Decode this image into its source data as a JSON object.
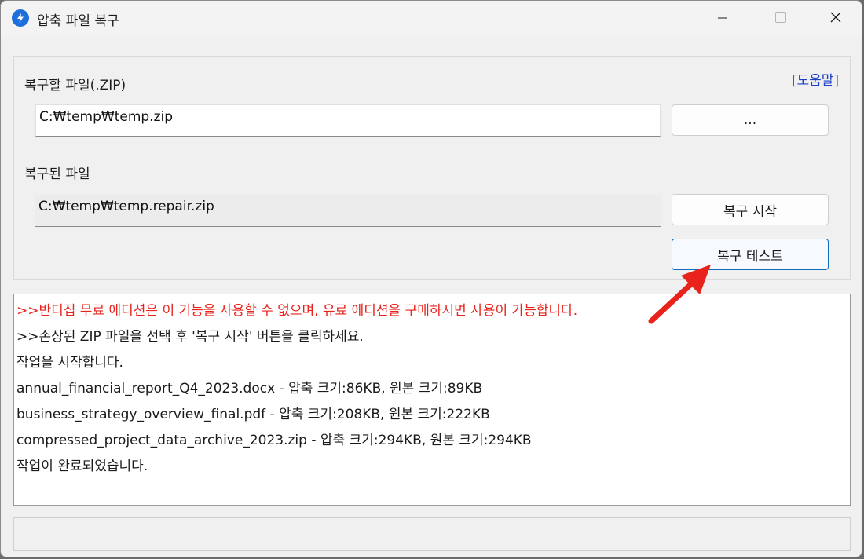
{
  "window": {
    "title": "압축 파일 복구"
  },
  "form": {
    "source_label": "복구할 파일(.ZIP)",
    "help_link": "[도움말]",
    "source_value": "C:₩temp₩temp.zip",
    "browse_label": "...",
    "output_label": "복구된 파일",
    "output_value": "C:₩temp₩temp.repair.zip",
    "start_label": "복구 시작",
    "test_label": "복구 테스트"
  },
  "log": {
    "lines": [
      ">>반디집 무료 에디션은 이 기능을 사용할 수 없으며, 유료 에디션을 구매하시면 사용이 가능합니다.",
      ">>손상된 ZIP 파일을 선택 후 '복구 시작' 버튼을 클릭하세요.",
      "작업을 시작합니다.",
      "annual_financial_report_Q4_2023.docx - 압축 크기:86KB, 원본 크기:89KB",
      "business_strategy_overview_final.pdf - 압축 크기:208KB, 원본 크기:222KB",
      "compressed_project_data_archive_2023.zip - 압축 크기:294KB, 원본 크기:294KB",
      "작업이 완료되었습니다."
    ],
    "warning_color": "#e8231b"
  },
  "colors": {
    "accent": "#1e6fd9",
    "link": "#1c3fc8",
    "arrow": "#e8231b"
  },
  "icons": {
    "app": "bandizip-app-icon",
    "minimize": "minimize-icon",
    "maximize": "maximize-icon",
    "close": "close-icon",
    "annotation": "red-arrow-icon"
  }
}
